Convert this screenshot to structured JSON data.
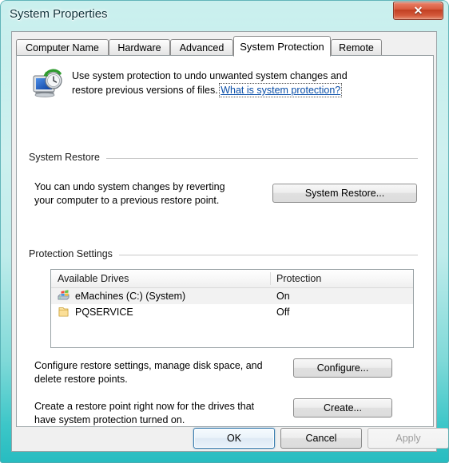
{
  "window": {
    "title": "System Properties",
    "close_label": "✕"
  },
  "tabs": [
    {
      "label": "Computer Name",
      "selected": false
    },
    {
      "label": "Hardware",
      "selected": false
    },
    {
      "label": "Advanced",
      "selected": false
    },
    {
      "label": "System Protection",
      "selected": true
    },
    {
      "label": "Remote",
      "selected": false
    }
  ],
  "header": {
    "icon": "system-restore-icon",
    "text_line1": "Use system protection to undo unwanted system changes and",
    "text_line2": "restore previous versions of files.",
    "link_label": "What is system protection?"
  },
  "system_restore": {
    "group_label": "System Restore",
    "description_line1": "You can undo system changes by reverting",
    "description_line2": "your computer to a previous restore point.",
    "button_label": "System Restore..."
  },
  "protection_settings": {
    "group_label": "Protection Settings",
    "columns": [
      "Available Drives",
      "Protection"
    ],
    "rows": [
      {
        "icon": "system-drive-icon",
        "name": "eMachines (C:) (System)",
        "protection": "On",
        "highlighted": true
      },
      {
        "icon": "folder-drive-icon",
        "name": "PQSERVICE",
        "protection": "Off",
        "highlighted": false
      }
    ],
    "configure": {
      "description_line1": "Configure restore settings, manage disk space, and",
      "description_line2": "delete restore points.",
      "button_label": "Configure..."
    },
    "create": {
      "description_line1": "Create a restore point right now for the drives that",
      "description_line2": "have system protection turned on.",
      "button_label": "Create..."
    }
  },
  "footer": {
    "ok_label": "OK",
    "cancel_label": "Cancel",
    "apply_label": "Apply",
    "apply_disabled": true
  },
  "colors": {
    "frame_glass": "#a8e5e3",
    "frame_glass_bottom": "#27bcc0",
    "close_red": "#c13f22",
    "link_blue": "#0b4fa8",
    "default_button_border": "#3c7fb1",
    "dialog_face": "#f0f0f0",
    "page_white": "#ffffff"
  }
}
